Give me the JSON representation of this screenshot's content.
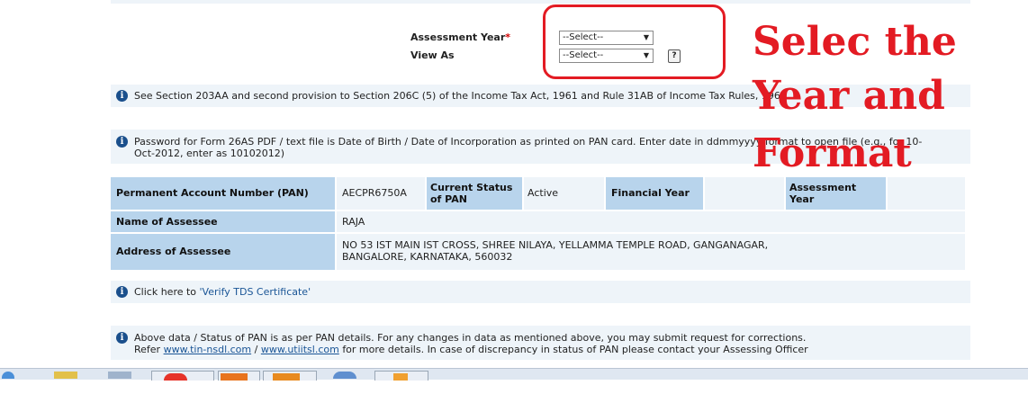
{
  "form": {
    "assessment_year_label": "Assessment Year",
    "required_mark": "*",
    "assessment_year_value": "--Select--",
    "view_as_label": "View As",
    "view_as_value": "--Select--",
    "help_glyph": "?"
  },
  "notes": {
    "section_note": "See Section 203AA and second provision to Section 206C (5) of the Income Tax Act, 1961 and Rule 31AB of Income Tax Rules, 1962",
    "password_note": "Password for Form 26AS PDF / text file is Date of Birth / Date of Incorporation as printed on PAN card. Enter date in ddmmyyyy format to open file (e.g., for 10-Oct-2012, enter as 10102012)",
    "verify_prefix": "Click here to ",
    "verify_link": "'Verify TDS Certificate'",
    "footer_line1": "Above data / Status of PAN is as per PAN details. For any changes in data as mentioned above, you may submit request for corrections.",
    "footer_refer": "Refer",
    "footer_link1": "www.tin-nsdl.com",
    "footer_sep": "/",
    "footer_link2": "www.utiitsl.com",
    "footer_rest": "for more details. In case of discrepancy in status of PAN please contact your Assessing Officer"
  },
  "pan_table": {
    "pan_label": "Permanent Account Number (PAN)",
    "pan_value": "AECPR6750A",
    "status_label": "Current Status of PAN",
    "status_value": "Active",
    "fy_label": "Financial Year",
    "fy_value": "",
    "ay_label": "Assessment Year",
    "ay_value": "",
    "name_label": "Name of Assessee",
    "name_value": "RAJA",
    "address_label": "Address of Assessee",
    "address_value": "NO 53 IST MAIN IST CROSS, SHREE NILAYA, YELLAMMA TEMPLE ROAD, GANGANAGAR, BANGALORE, KARNATAKA, 560032"
  },
  "annotation": {
    "line1": "Selec the",
    "line2": "Year and",
    "line3": "Format"
  },
  "colors": {
    "annotation_red": "#e31b23",
    "header_blue": "#b8d4ec",
    "row_light": "#eef4f9",
    "info_icon": "#1a4f8c"
  }
}
